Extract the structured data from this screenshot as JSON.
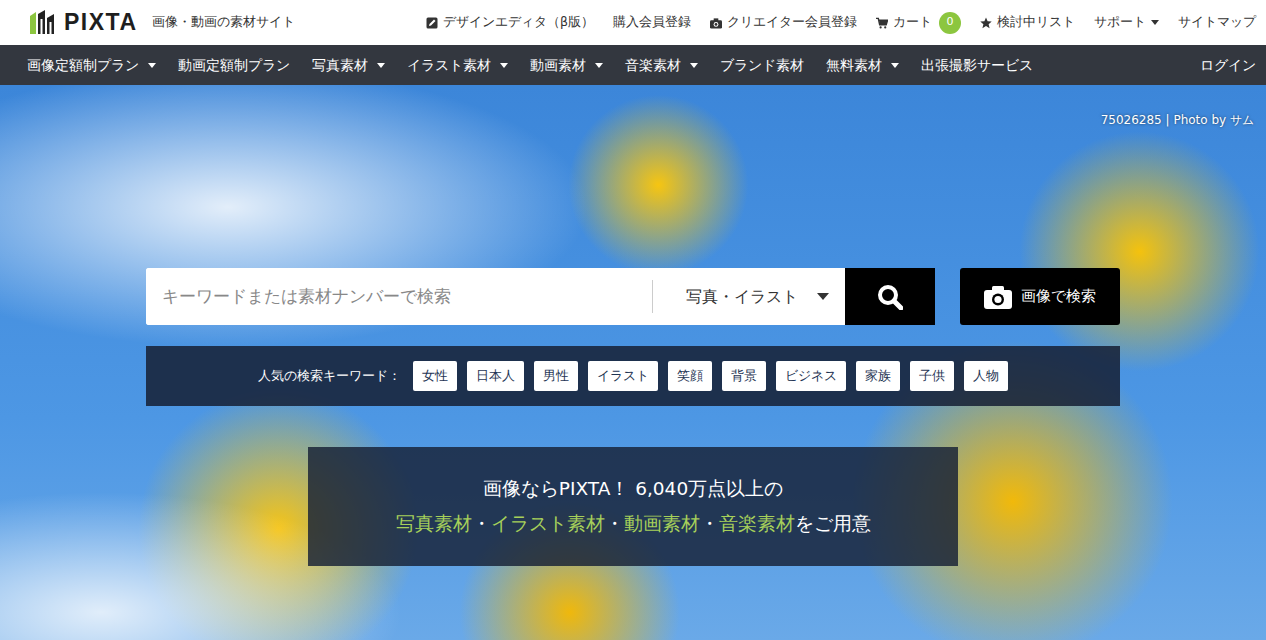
{
  "header": {
    "logo": "PIXTA",
    "tagline": "画像・動画の素材サイト",
    "links": [
      {
        "label": "デザインエディタ（β版）",
        "kind": "editor"
      },
      {
        "label": "購入会員登録",
        "kind": "plain"
      },
      {
        "label": "クリエイター会員登録",
        "kind": "camera"
      },
      {
        "label": "カート",
        "kind": "cart",
        "badge": "0"
      },
      {
        "label": "検討中リスト",
        "kind": "star"
      },
      {
        "label": "サポート",
        "kind": "menu"
      },
      {
        "label": "サイトマップ",
        "kind": "plain"
      }
    ]
  },
  "nav": {
    "items": [
      {
        "label": "画像定額制プラン",
        "dropdown": true
      },
      {
        "label": "動画定額制プラン",
        "dropdown": false
      },
      {
        "label": "写真素材",
        "dropdown": true
      },
      {
        "label": "イラスト素材",
        "dropdown": true
      },
      {
        "label": "動画素材",
        "dropdown": true
      },
      {
        "label": "音楽素材",
        "dropdown": true
      },
      {
        "label": "ブランド素材",
        "dropdown": false
      },
      {
        "label": "無料素材",
        "dropdown": true
      },
      {
        "label": "出張撮影サービス",
        "dropdown": false
      }
    ],
    "login": "ログイン"
  },
  "hero": {
    "credit": "75026285 | Photo by サム"
  },
  "search": {
    "placeholder": "キーワードまたは素材ナンバーで検索",
    "category": "写真・イラスト",
    "image_search": "画像で検索"
  },
  "popular": {
    "label": "人気の検索キーワード：",
    "keywords": [
      "女性",
      "日本人",
      "男性",
      "イラスト",
      "笑顔",
      "背景",
      "ビジネス",
      "家族",
      "子供",
      "人物"
    ]
  },
  "promo": {
    "line1": "画像ならPIXTA！ 6,040万点以上の",
    "links": [
      "写真素材",
      "イラスト素材",
      "動画素材",
      "音楽素材"
    ],
    "separator": "・",
    "suffix": "をご用意"
  }
}
